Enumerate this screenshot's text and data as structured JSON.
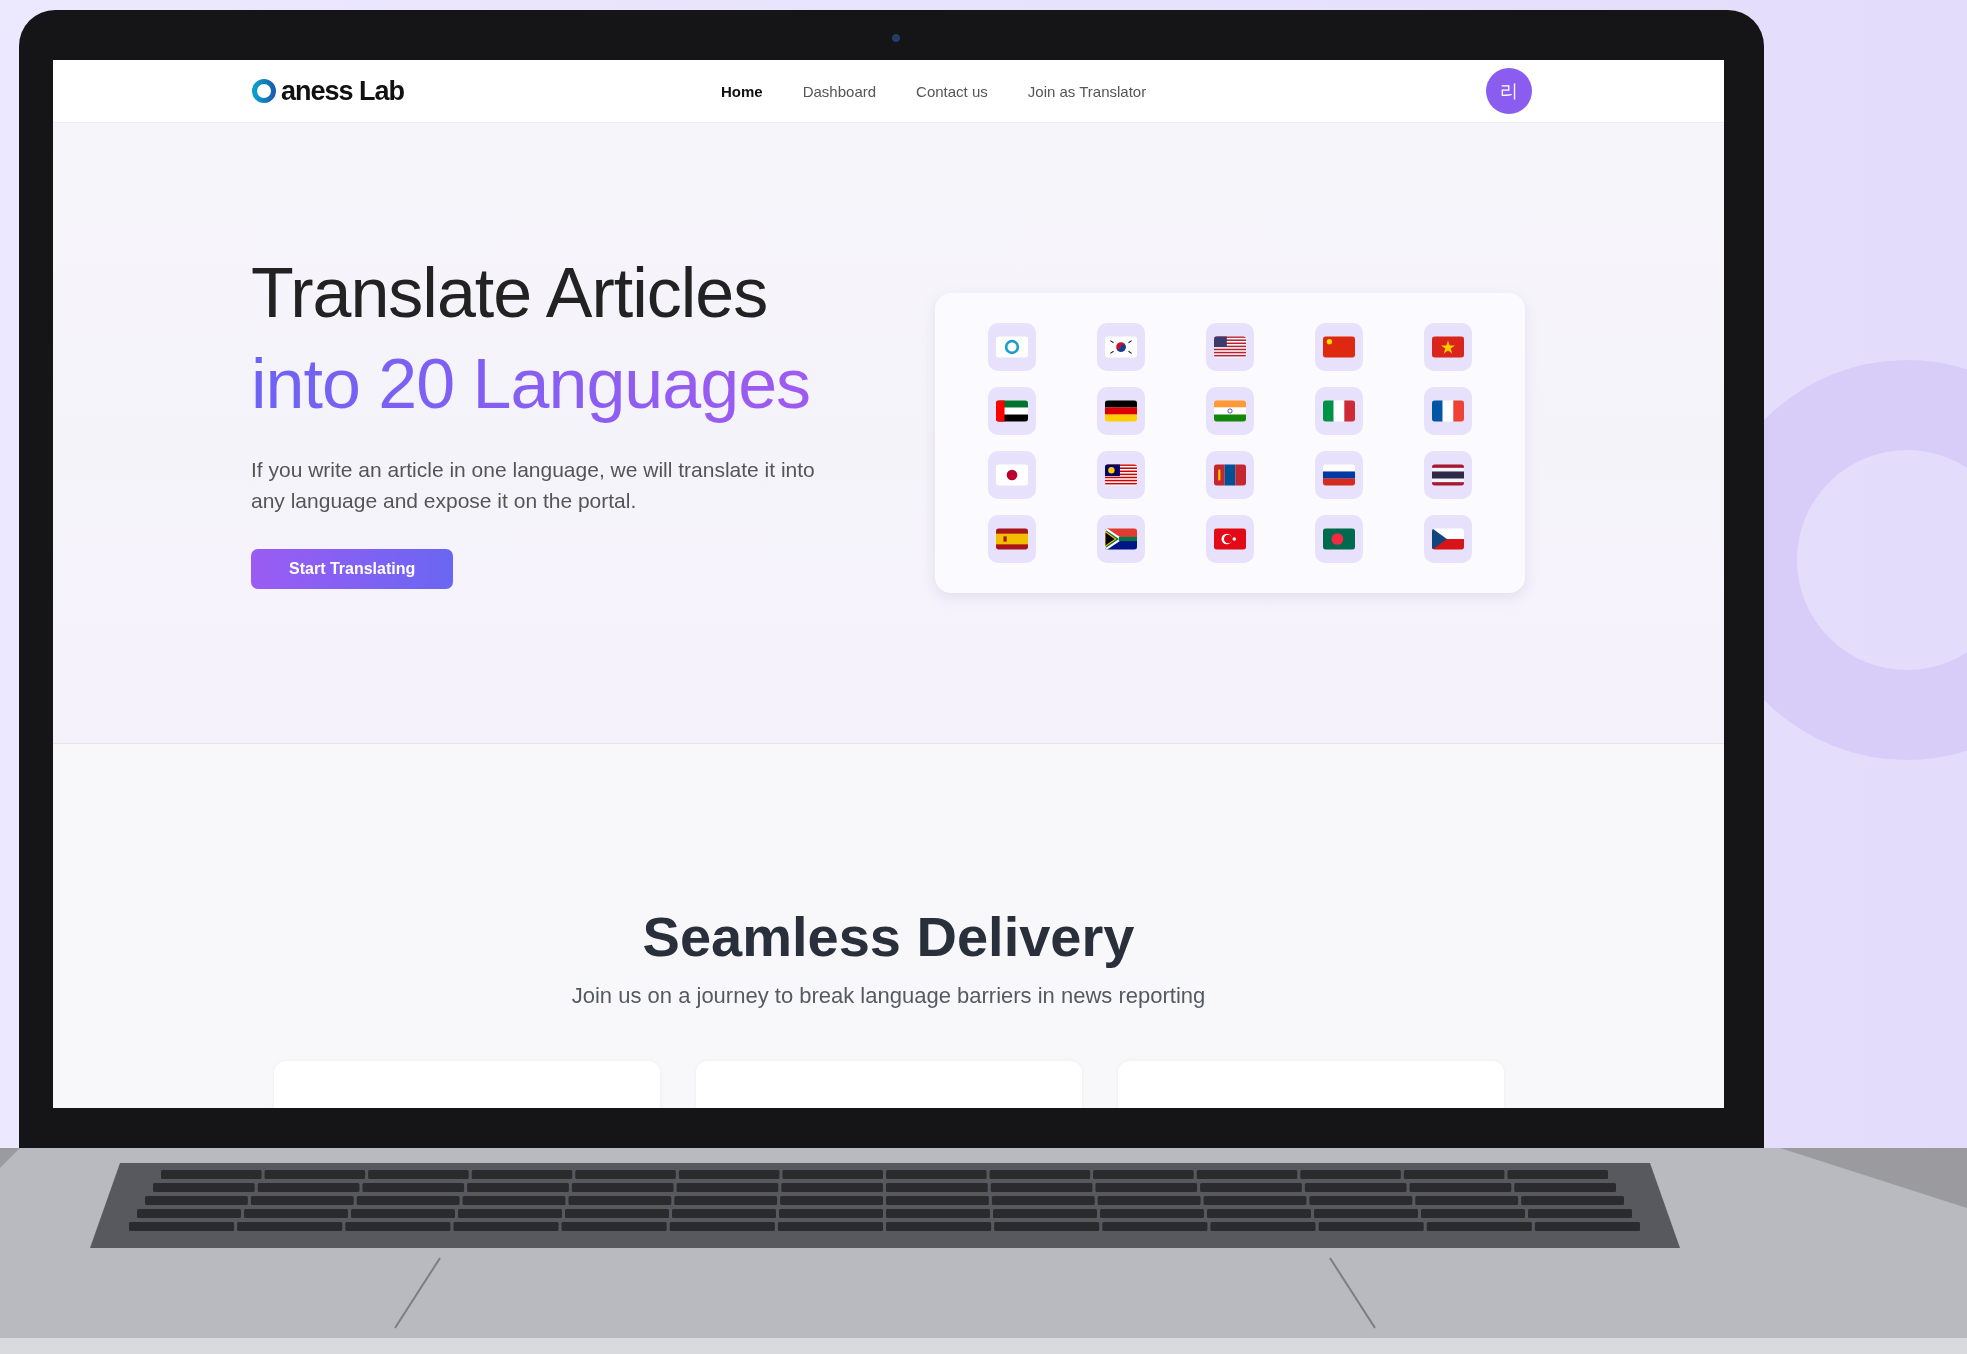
{
  "nav": {
    "logo": "aness Lab",
    "links": [
      {
        "label": "Home",
        "selected": true
      },
      {
        "label": "Dashboard",
        "selected": false
      },
      {
        "label": "Contact us",
        "selected": false
      },
      {
        "label": "Join as Translator",
        "selected": false
      }
    ],
    "avatar": "리"
  },
  "hero": {
    "title": "Translate Articles",
    "title_highlight": "into 20 Languages",
    "description": "If you write an article in one language, we will translate it into any language and expose it on the portal.",
    "button": "Start Translating"
  },
  "flags": [
    {
      "kind": "logo"
    },
    {
      "kind": "korea"
    },
    {
      "kind": "usa"
    },
    {
      "kind": "china"
    },
    {
      "kind": "vietnam"
    },
    {
      "kind": "uae"
    },
    {
      "kind": "germany"
    },
    {
      "kind": "india"
    },
    {
      "kind": "italy"
    },
    {
      "kind": "france"
    },
    {
      "kind": "japan"
    },
    {
      "kind": "malaysia"
    },
    {
      "kind": "mongolia"
    },
    {
      "kind": "russia"
    },
    {
      "kind": "thailand"
    },
    {
      "kind": "spain"
    },
    {
      "kind": "southafrica"
    },
    {
      "kind": "turkey"
    },
    {
      "kind": "bangladesh"
    },
    {
      "kind": "czech"
    }
  ],
  "delivery": {
    "title": "Seamless Delivery",
    "subtitle": "Join us on a journey to break language barriers in news reporting"
  }
}
